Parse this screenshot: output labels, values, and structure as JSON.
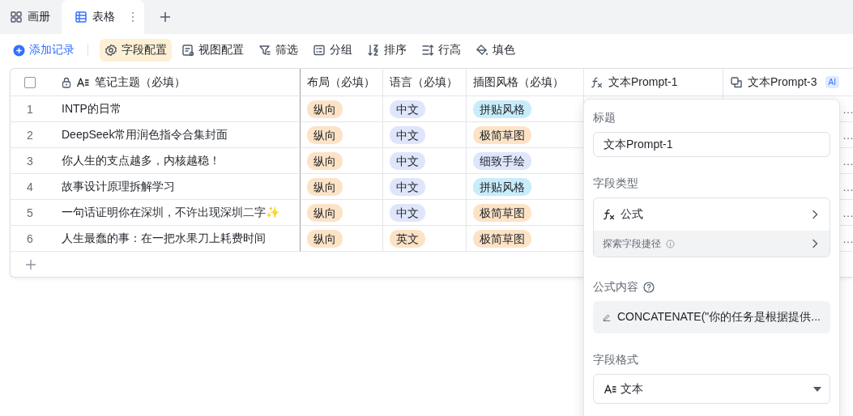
{
  "tabs": [
    {
      "label": "画册",
      "kind": "gallery",
      "selected": false
    },
    {
      "label": "表格",
      "kind": "grid",
      "selected": true
    }
  ],
  "toolbar": {
    "add_record": "添加记录",
    "items": [
      {
        "label": "字段配置",
        "kind": "fields",
        "selected": true
      },
      {
        "label": "视图配置",
        "kind": "view",
        "selected": false
      },
      {
        "label": "筛选",
        "kind": "filter",
        "selected": false
      },
      {
        "label": "分组",
        "kind": "group",
        "selected": false
      },
      {
        "label": "排序",
        "kind": "sort",
        "selected": false
      },
      {
        "label": "行高",
        "kind": "height",
        "selected": false
      },
      {
        "label": "填色",
        "kind": "fill",
        "selected": false
      }
    ]
  },
  "table": {
    "select_all": {
      "checked": false
    },
    "columns": [
      {
        "label": "笔记主题（必填）",
        "kind": "primary"
      },
      {
        "label": "布局（必填）",
        "kind": "plain"
      },
      {
        "label": "语言（必填）",
        "kind": "plain"
      },
      {
        "label": "插图风格（必填）",
        "kind": "plain"
      },
      {
        "label": "文本Prompt-1",
        "kind": "formula"
      },
      {
        "label": "文本Prompt-3",
        "kind": "ai",
        "badge": "AI"
      }
    ],
    "rows": [
      {
        "number": "1",
        "title": "INTP的日常",
        "tags": [
          {
            "text": "纵向",
            "color": "#fde3c6"
          },
          {
            "text": "中文",
            "color": "#dfe6fb"
          },
          {
            "text": "拼贴风格",
            "color": "#c8ecfa"
          }
        ],
        "column_7": "…"
      },
      {
        "number": "2",
        "title": "DeepSeek常用润色指令合集封面",
        "tags": [
          {
            "text": "纵向",
            "color": "#fde3c6"
          },
          {
            "text": "中文",
            "color": "#dfe6fb"
          },
          {
            "text": "极简草图",
            "color": "#fde3c6"
          }
        ],
        "column_7": "…"
      },
      {
        "number": "3",
        "title": "你人生的支点越多，内核越稳！",
        "tags": [
          {
            "text": "纵向",
            "color": "#fde3c6"
          },
          {
            "text": "中文",
            "color": "#dfe6fb"
          },
          {
            "text": "细致手绘",
            "color": "#dfe6fb"
          }
        ],
        "column_7": "…"
      },
      {
        "number": "4",
        "title": "故事设计原理拆解学习",
        "tags": [
          {
            "text": "纵向",
            "color": "#fde3c6"
          },
          {
            "text": "中文",
            "color": "#dfe6fb"
          },
          {
            "text": "拼贴风格",
            "color": "#c8ecfa"
          }
        ],
        "column_7": "…"
      },
      {
        "number": "5",
        "title": "一句话证明你在深圳，不许出现深圳二字✨",
        "tags": [
          {
            "text": "纵向",
            "color": "#fde3c6"
          },
          {
            "text": "中文",
            "color": "#dfe6fb"
          },
          {
            "text": "极简草图",
            "color": "#fde3c6"
          }
        ],
        "column_7": "…"
      },
      {
        "number": "6",
        "title": "人生最蠢的事：在一把水果刀上耗费时间",
        "tags": [
          {
            "text": "纵向",
            "color": "#fde3c6"
          },
          {
            "text": "英文",
            "color": "#fde3c6"
          },
          {
            "text": "极简草图",
            "color": "#fde3c6"
          }
        ],
        "column_7": "…"
      }
    ]
  },
  "field_panel": {
    "title_label": "标题",
    "title_value": "文本Prompt-1",
    "type_label": "字段类型",
    "type_value": "公式",
    "shortcut": "探索字段捷径",
    "formula_label": "公式内容",
    "formula": "CONCATENATE(\"你的任务是根据提供...",
    "format_label": "字段格式",
    "format_value": "文本"
  }
}
